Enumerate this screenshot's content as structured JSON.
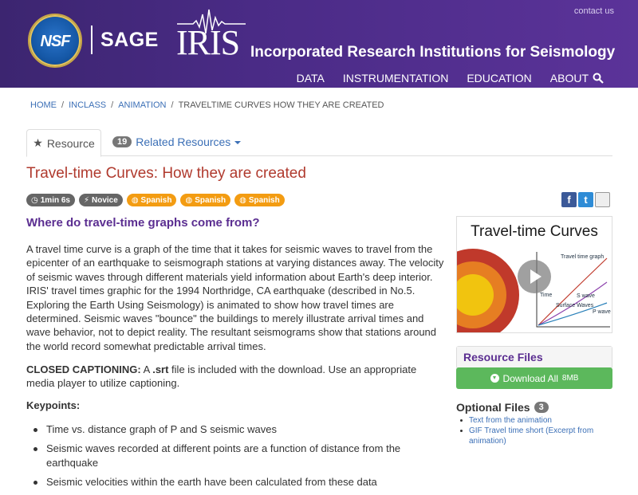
{
  "header": {
    "contact": "contact us",
    "nsf_label": "NSF",
    "sage_label": "SAGE",
    "iris_label": "IRIS",
    "iris_full": "Incorporated Research Institutions for Seismology",
    "nav": [
      "DATA",
      "INSTRUMENTATION",
      "EDUCATION",
      "ABOUT"
    ],
    "search_icon": "search-icon"
  },
  "breadcrumb": {
    "home": "HOME",
    "inclass": "INCLASS",
    "animation": "ANIMATION",
    "current": "TRAVELTIME CURVES HOW THEY ARE CREATED"
  },
  "tabs": {
    "resource": "Resource",
    "related_count": "19",
    "related": "Related Resources"
  },
  "title": "Travel-time Curves: How they are created",
  "badges": {
    "duration": "1min 6s",
    "level": "Novice",
    "lang1": "Spanish",
    "lang2": "Spanish",
    "lang3": "Spanish"
  },
  "share": {
    "fb": "f",
    "tw": "t"
  },
  "subhead": "Where do travel-time graphs come from?",
  "body": "A travel time curve is a graph of the time that it takes for seismic waves to travel from the epicenter of an earthquake to seismograph stations at varying distances away. The velocity of seismic waves through different materials yield information about Earth's deep interior. IRIS' travel times graphic for the 1994 Northridge, CA earthquake (described in No.5. Exploring the Earth Using Seismology) is animated to show how travel times are determined. Seismic waves \"bounce\" the buildings to merely illustrate arrival times and wave behavior, not to depict reality. The resultant seismograms show that stations around the world record somewhat predictable arrival times.",
  "cc": {
    "label": "CLOSED CAPTIONING:",
    "pre": " A ",
    "ext": ".srt",
    "post": " file is included with the download. Use an appropriate media player to utilize captioning."
  },
  "keypoints_label": "Keypoints:",
  "keypoints": [
    "Time vs. distance graph of P and S seismic waves",
    "Seismic waves recorded at different points are a function of distance from the earthquake",
    "Seismic velocities within the earth have been calculated from these data"
  ],
  "video": {
    "title": "Travel-time Curves",
    "graph_label": "Travel time graph",
    "time_axis": "Time",
    "surface": "Surface Waves",
    "s_wave": "S wave",
    "p_wave": "P wave"
  },
  "resource_files": {
    "heading": "Resource Files",
    "download": "Download All",
    "size": "8MB"
  },
  "optional": {
    "heading": "Optional Files",
    "count": "3",
    "items": [
      "Text from the animation",
      "GIF Travel time short (Excerpt from animation)"
    ]
  }
}
